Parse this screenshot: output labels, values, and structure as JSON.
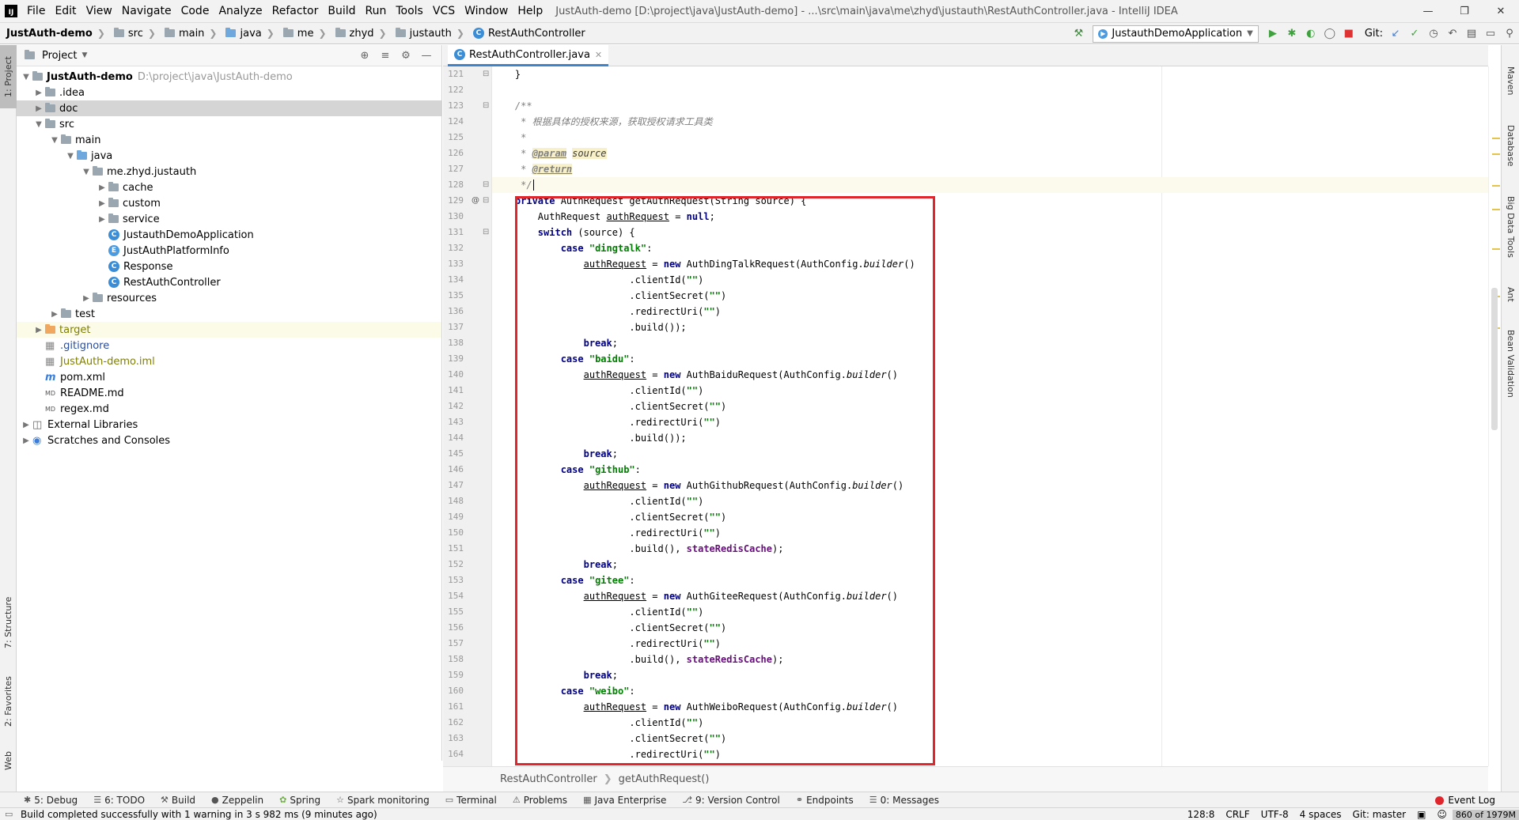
{
  "menu": {
    "items": [
      "File",
      "Edit",
      "View",
      "Navigate",
      "Code",
      "Analyze",
      "Refactor",
      "Build",
      "Run",
      "Tools",
      "VCS",
      "Window",
      "Help"
    ],
    "window_title": "JustAuth-demo [D:\\project\\java\\JustAuth-demo] - ...\\src\\main\\java\\me\\zhyd\\justauth\\RestAuthController.java - IntelliJ IDEA"
  },
  "navbar": {
    "crumbs": [
      "JustAuth-demo",
      "src",
      "main",
      "java",
      "me",
      "zhyd",
      "justauth",
      "RestAuthController"
    ],
    "run_config": "JustauthDemoApplication",
    "git_label": "Git:"
  },
  "left_strip": {
    "project": "1: Project",
    "structure": "7: Structure",
    "favorites": "2: Favorites",
    "web": "Web"
  },
  "right_strip": {
    "maven": "Maven",
    "database": "Database",
    "bigdata": "Big Data Tools",
    "ant": "Ant",
    "bean": "Bean Validation"
  },
  "project": {
    "header": "Project",
    "tree": [
      {
        "label": "JustAuth-demo",
        "path": "D:\\project\\java\\JustAuth-demo"
      },
      {
        "label": ".idea"
      },
      {
        "label": "doc"
      },
      {
        "label": "src"
      },
      {
        "label": "main"
      },
      {
        "label": "java"
      },
      {
        "label": "me.zhyd.justauth"
      },
      {
        "label": "cache"
      },
      {
        "label": "custom"
      },
      {
        "label": "service"
      },
      {
        "label": "JustauthDemoApplication"
      },
      {
        "label": "JustAuthPlatformInfo"
      },
      {
        "label": "Response"
      },
      {
        "label": "RestAuthController"
      },
      {
        "label": "resources"
      },
      {
        "label": "test"
      },
      {
        "label": "target"
      },
      {
        "label": ".gitignore"
      },
      {
        "label": "JustAuth-demo.iml"
      },
      {
        "label": "pom.xml"
      },
      {
        "label": "README.md"
      },
      {
        "label": "regex.md"
      },
      {
        "label": "External Libraries"
      },
      {
        "label": "Scratches and Consoles"
      }
    ]
  },
  "editor": {
    "tab": "RestAuthController.java",
    "line_numbers": [
      "121",
      "122",
      "123",
      "124",
      "125",
      "126",
      "127",
      "128",
      "129",
      "130",
      "131",
      "132",
      "133",
      "134",
      "135",
      "136",
      "137",
      "138",
      "139",
      "140",
      "141",
      "142",
      "143",
      "144",
      "145",
      "146",
      "147",
      "148",
      "149",
      "150",
      "151",
      "152",
      "153",
      "154",
      "155",
      "156",
      "157",
      "158",
      "159",
      "160",
      "161",
      "162",
      "163",
      "164"
    ],
    "breadcrumb": [
      "RestAuthController",
      "getAuthRequest()"
    ]
  },
  "bottom_tools": [
    "5: Debug",
    "6: TODO",
    "Build",
    "Zeppelin",
    "Spring",
    "Spark monitoring",
    "Terminal",
    "Problems",
    "Java Enterprise",
    "9: Version Control",
    "Endpoints",
    "0: Messages"
  ],
  "event_log": "Event Log",
  "status": {
    "message": "Build completed successfully with 1 warning in 3 s 982 ms (9 minutes ago)",
    "position": "128:8",
    "line_sep": "CRLF",
    "encoding": "UTF-8",
    "indent": "4 spaces",
    "git": "Git: master",
    "memory": "860 of 1979M"
  }
}
